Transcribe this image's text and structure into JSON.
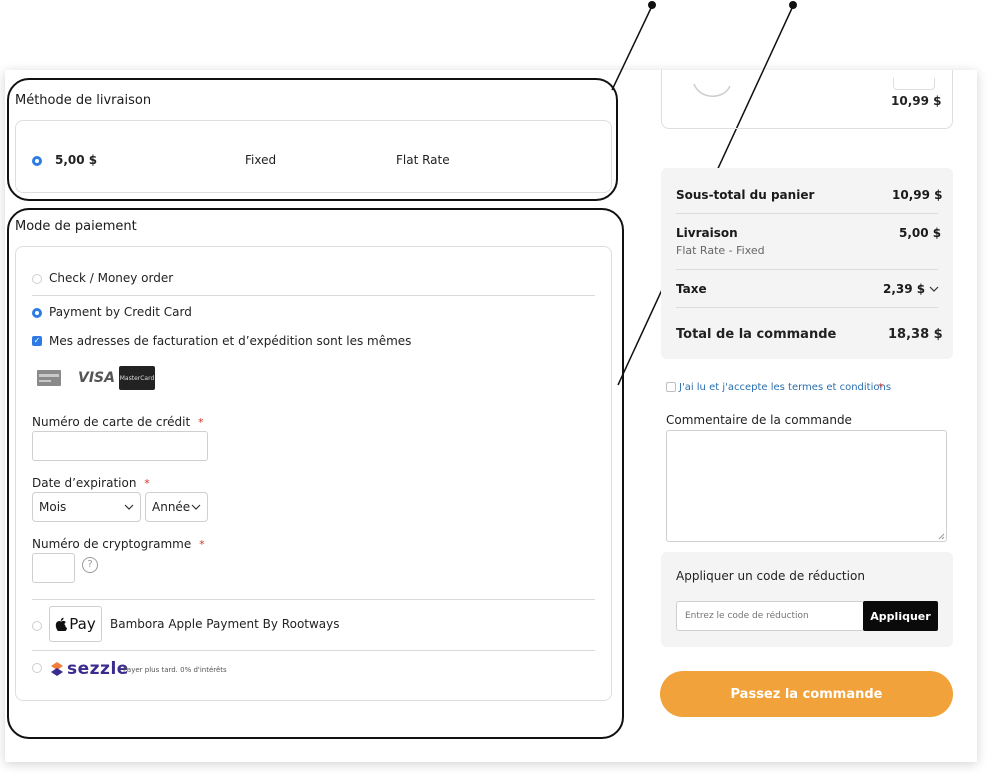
{
  "shipping": {
    "title": "Méthode de livraison",
    "price": "5,00 $",
    "method": "Fixed",
    "carrier": "Flat Rate"
  },
  "payment": {
    "title": "Mode de paiement",
    "option_check": "Check / Money order",
    "option_credit": "Payment by Credit Card",
    "same_address": "Mes adresses de facturation et d’expédition sont les mêmes",
    "cards": [
      "amex-icon",
      "visa-icon",
      "mastercard-icon"
    ],
    "visa_label": "VISA",
    "mastercard_label": "MasterCard",
    "card_number_label": "Numéro de carte de crédit",
    "required_mark": "*",
    "expiry_label": "Date d’expiration",
    "month_select": "Mois",
    "year_select": "Année",
    "cvv_label": "Numéro de cryptogramme",
    "cvv_help": "?",
    "apple_pay_logo": "Pay",
    "apple_pay_label": "Bambora Apple Payment By Rootways",
    "sezzle_logo": "sezzle",
    "sezzle_label": "Payer plus tard. 0% d'intérêts"
  },
  "cart_item": {
    "price": "10,99 $"
  },
  "summary": {
    "subtotal_label": "Sous-total du panier",
    "subtotal_value": "10,99 $",
    "shipping_label": "Livraison",
    "shipping_value": "5,00 $",
    "shipping_sub": "Flat Rate - Fixed",
    "tax_label": "Taxe",
    "tax_value": "2,39 $",
    "total_label": "Total de la commande",
    "total_value": "18,38 $"
  },
  "terms": {
    "label": "J'ai lu et j'accepte les termes et conditions",
    "required_mark": "*"
  },
  "comment": {
    "label": "Commentaire de la commande"
  },
  "discount": {
    "title": "Appliquer un code de réduction",
    "placeholder": "Entrez le code de réduction",
    "button": "Appliquer"
  },
  "place_order": "Passez la commande",
  "colors": {
    "accent_blue": "#2f7be6",
    "order_button": "#f2a23a",
    "apply_button": "#0a0a0a",
    "required": "#d2352c"
  }
}
